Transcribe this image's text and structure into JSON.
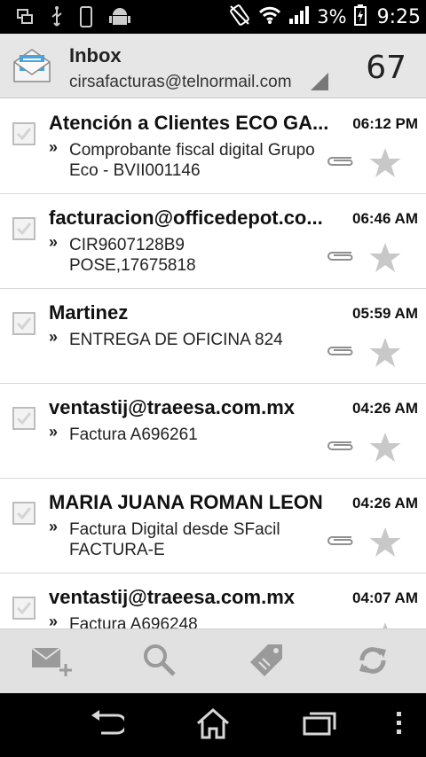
{
  "status_bar": {
    "battery_pct": "3%",
    "time": "9:25"
  },
  "header": {
    "title": "Inbox",
    "account": "cirsafacturas@telnormail.com",
    "unread_count": "67"
  },
  "emails": [
    {
      "sender": "Atención a Clientes ECO GA...",
      "time": "06:12 PM",
      "subject": "Comprobante fiscal digital Grupo Eco - BVII001146",
      "subject_marker": "»"
    },
    {
      "sender": "facturacion@officedepot.co...",
      "time": "06:46 AM",
      "subject": "CIR9607128B9 POSE,17675818",
      "subject_marker": "»"
    },
    {
      "sender": "Martinez",
      "time": "05:59 AM",
      "subject": "ENTREGA DE OFICINA 824",
      "subject_marker": "»"
    },
    {
      "sender": "ventastij@traeesa.com.mx",
      "time": "04:26 AM",
      "subject": "Factura A696261",
      "subject_marker": "»"
    },
    {
      "sender": "MARIA JUANA ROMAN LEON",
      "time": "04:26 AM",
      "subject": "Factura Digital desde SFacil FACTURA-E",
      "subject_marker": "»"
    },
    {
      "sender": "ventastij@traeesa.com.mx",
      "time": "04:07 AM",
      "subject": "Factura A696248",
      "subject_marker": "»"
    }
  ],
  "toolbar": {
    "buttons": [
      "compose-icon",
      "search-icon",
      "label-icon",
      "refresh-icon"
    ]
  },
  "navbar": {
    "buttons": [
      "back-icon",
      "home-icon",
      "recent-apps-icon",
      "overflow-menu-icon"
    ]
  },
  "colors": {
    "status_bar": "#000000",
    "header": "#e6e6e6",
    "toolbar": "#e1e1e1",
    "icon_gray": "#9a9a9a"
  }
}
